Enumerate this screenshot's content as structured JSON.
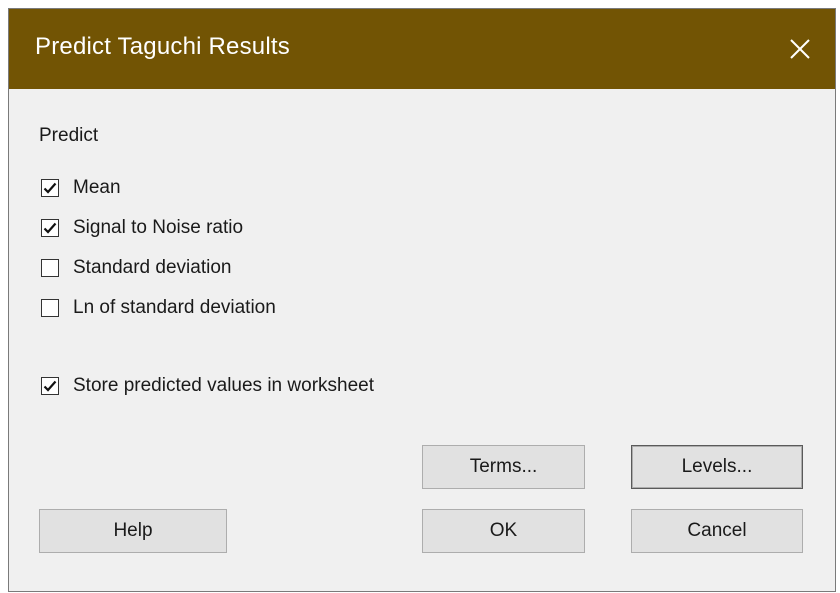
{
  "dialog": {
    "title": "Predict Taguchi Results",
    "close_symbol": "✕"
  },
  "predict": {
    "section_label": "Predict",
    "options": [
      {
        "label": "Mean",
        "checked": true
      },
      {
        "label": "Signal to Noise ratio",
        "checked": true
      },
      {
        "label": "Standard deviation",
        "checked": false
      },
      {
        "label": "Ln of standard deviation",
        "checked": false
      }
    ]
  },
  "store": {
    "label": "Store predicted values in worksheet",
    "checked": true
  },
  "buttons": {
    "terms": "Terms...",
    "levels": "Levels...",
    "help": "Help",
    "ok": "OK",
    "cancel": "Cancel"
  },
  "colors": {
    "titlebar": "#725404",
    "dialog_bg": "#f0f0f0",
    "button_bg": "#e1e1e1"
  }
}
